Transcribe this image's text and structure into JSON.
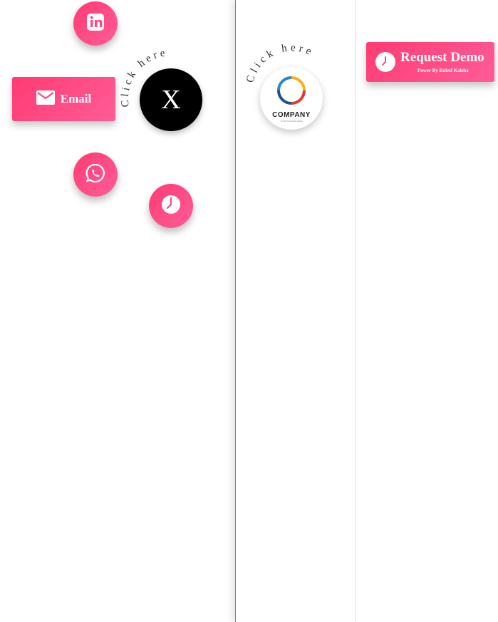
{
  "widgets": {
    "left": {
      "email_label": "Email",
      "close_label": "X",
      "curved_text": "Click here",
      "icons": [
        "linkedin-icon",
        "mail-icon",
        "whatsapp-icon",
        "clock-icon"
      ]
    },
    "middle": {
      "curved_text": "Click here",
      "company_name": "COMPANY",
      "company_tagline": "YOUR TAGLINE HERE"
    },
    "right": {
      "demo_title": "Request Demo",
      "demo_subtitle": "Power By Rahul Kalsha"
    }
  },
  "colors": {
    "accent_start": "#ff3b72",
    "accent_end": "#ff5c98",
    "close_bg": "#000000",
    "panel_bg": "#ffffff"
  }
}
